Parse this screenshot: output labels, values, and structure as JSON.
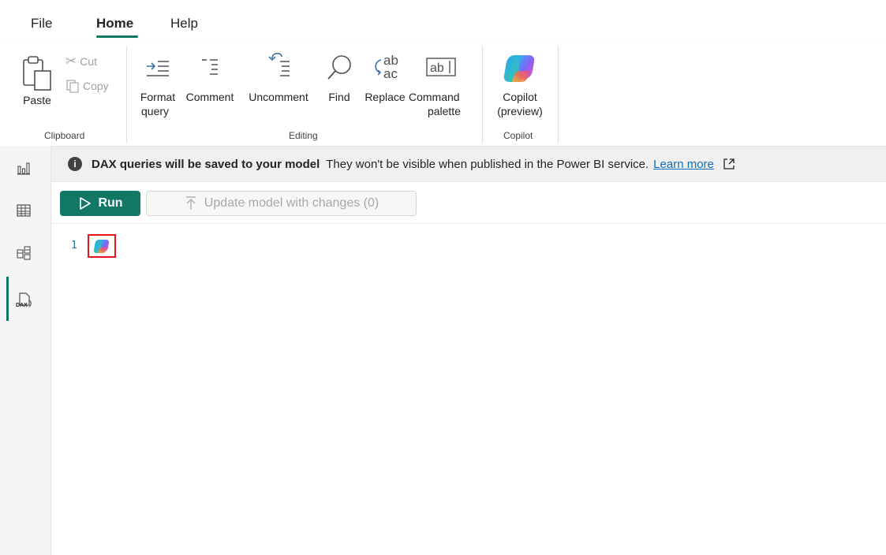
{
  "menu": {
    "tabs": [
      {
        "label": "File"
      },
      {
        "label": "Home"
      },
      {
        "label": "Help"
      }
    ]
  },
  "ribbon": {
    "clipboard": {
      "paste_label": "Paste",
      "cut_label": "Cut",
      "copy_label": "Copy",
      "group_label": "Clipboard"
    },
    "editing": {
      "format_label_1": "Format",
      "format_label_2": "query",
      "comment_label": "Comment",
      "uncomment_label": "Uncomment",
      "find_label": "Find",
      "replace_label": "Replace",
      "command_label_1": "Command",
      "command_label_2": "palette",
      "group_label": "Editing"
    },
    "copilot": {
      "label_1": "Copilot",
      "label_2": "(preview)",
      "group_label": "Copilot"
    }
  },
  "infobar": {
    "icon": "info-icon",
    "title": "DAX queries will be saved to your model",
    "message": "They won't be visible when published in the Power BI service.",
    "link": "Learn more"
  },
  "toolbar": {
    "run_label": "Run",
    "update_label": "Update model with changes (0)"
  },
  "editor": {
    "line_number": "1"
  },
  "colors": {
    "accent": "#117865",
    "link": "#0f6cbd",
    "highlight_box": "#e8151b"
  }
}
